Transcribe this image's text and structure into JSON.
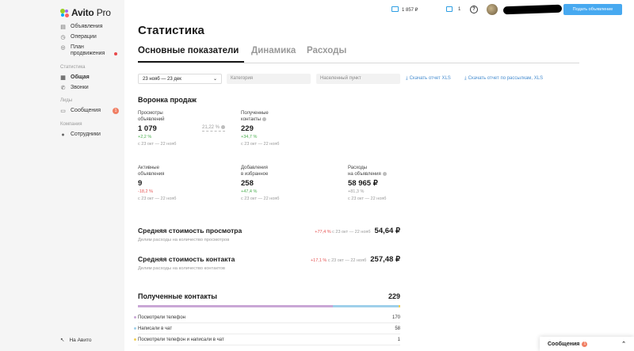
{
  "brand": {
    "name": "Avito",
    "suffix": "Pro"
  },
  "sidebar": {
    "items": [
      {
        "label": "Объявления",
        "icon": "list-icon"
      },
      {
        "label": "Операции",
        "icon": "clock-icon"
      },
      {
        "label": "План продвижения",
        "icon": "target-icon"
      }
    ],
    "section_stats": "Статистика",
    "stats_items": [
      {
        "label": "Общая",
        "icon": "chart-icon"
      },
      {
        "label": "Звонки",
        "icon": "phone-icon"
      }
    ],
    "section_leads": "Лиды",
    "leads_items": [
      {
        "label": "Сообщения",
        "icon": "chat-icon",
        "badge": "1"
      }
    ],
    "section_company": "Компания",
    "company_items": [
      {
        "label": "Сотрудники",
        "icon": "user-icon"
      }
    ],
    "bottom_link": "На Авито"
  },
  "topbar": {
    "balance": "1 857 ₽",
    "messages_count": "1",
    "help": "?",
    "post_button": "Подать объявление"
  },
  "page": {
    "title": "Статистика",
    "tabs": [
      "Основные показатели",
      "Динамика",
      "Расходы"
    ]
  },
  "filters": {
    "date_range": "23 нояб — 23 дек",
    "category_placeholder": "Категория",
    "city_placeholder": "Населенный пункт",
    "download_xls": "Скачать отчет XLS",
    "download_mailing": "Скачать отчет по рассылкам, XLS"
  },
  "funnel": {
    "title": "Воронка продаж",
    "ratio": "21,22 %",
    "metrics": [
      {
        "label1": "Просмотры",
        "label2": "объявлений",
        "value": "1 079",
        "change": "+2,2 %",
        "dir": "up",
        "period": "с 23 окт — 22 нояб"
      },
      {
        "label1": "Полученные",
        "label2": "контакты",
        "value": "229",
        "change": "+34,7 %",
        "dir": "up",
        "period": "с 23 окт — 22 нояб"
      },
      {
        "label1": "Активные",
        "label2": "объявления",
        "value": "9",
        "change": "-18,2 %",
        "dir": "down",
        "period": "с 23 окт — 22 нояб"
      },
      {
        "label1": "Добавления",
        "label2": "в избранное",
        "value": "258",
        "change": "+47,4 %",
        "dir": "up",
        "period": "с 23 окт — 22 нояб"
      },
      {
        "label1": "Расходы",
        "label2": "на объявления",
        "value": "58 965 ₽",
        "change": "+81,3 %",
        "dir": "neutral",
        "period": "с 23 окт — 22 нояб"
      }
    ]
  },
  "costs": [
    {
      "title": "Средняя стоимость просмотра",
      "sub": "Делим расходы на количество просмотров",
      "change": "+77,4 %",
      "period": "с 23 окт — 22 нояб",
      "value": "54,64 ₽"
    },
    {
      "title": "Средняя стоимость контакта",
      "sub": "Делим расходы на количество контактов",
      "change": "+17,1 %",
      "period": "с 23 окт — 22 нояб",
      "value": "257,48 ₽"
    }
  ],
  "contacts": {
    "title": "Полученные контакты",
    "total": "229",
    "rows": [
      {
        "label": "Посмотрели телефон",
        "count": "170",
        "share": 0.742,
        "color": "#c9a7d6"
      },
      {
        "label": "Написали в чат",
        "count": "58",
        "share": 0.253,
        "color": "#9fd0ea"
      },
      {
        "label": "Посмотрели телефон и написали в чат",
        "count": "1",
        "share": 0.005,
        "color": "#f2d05a"
      }
    ]
  },
  "messages_popup": {
    "label": "Сообщения",
    "badge": "1"
  }
}
